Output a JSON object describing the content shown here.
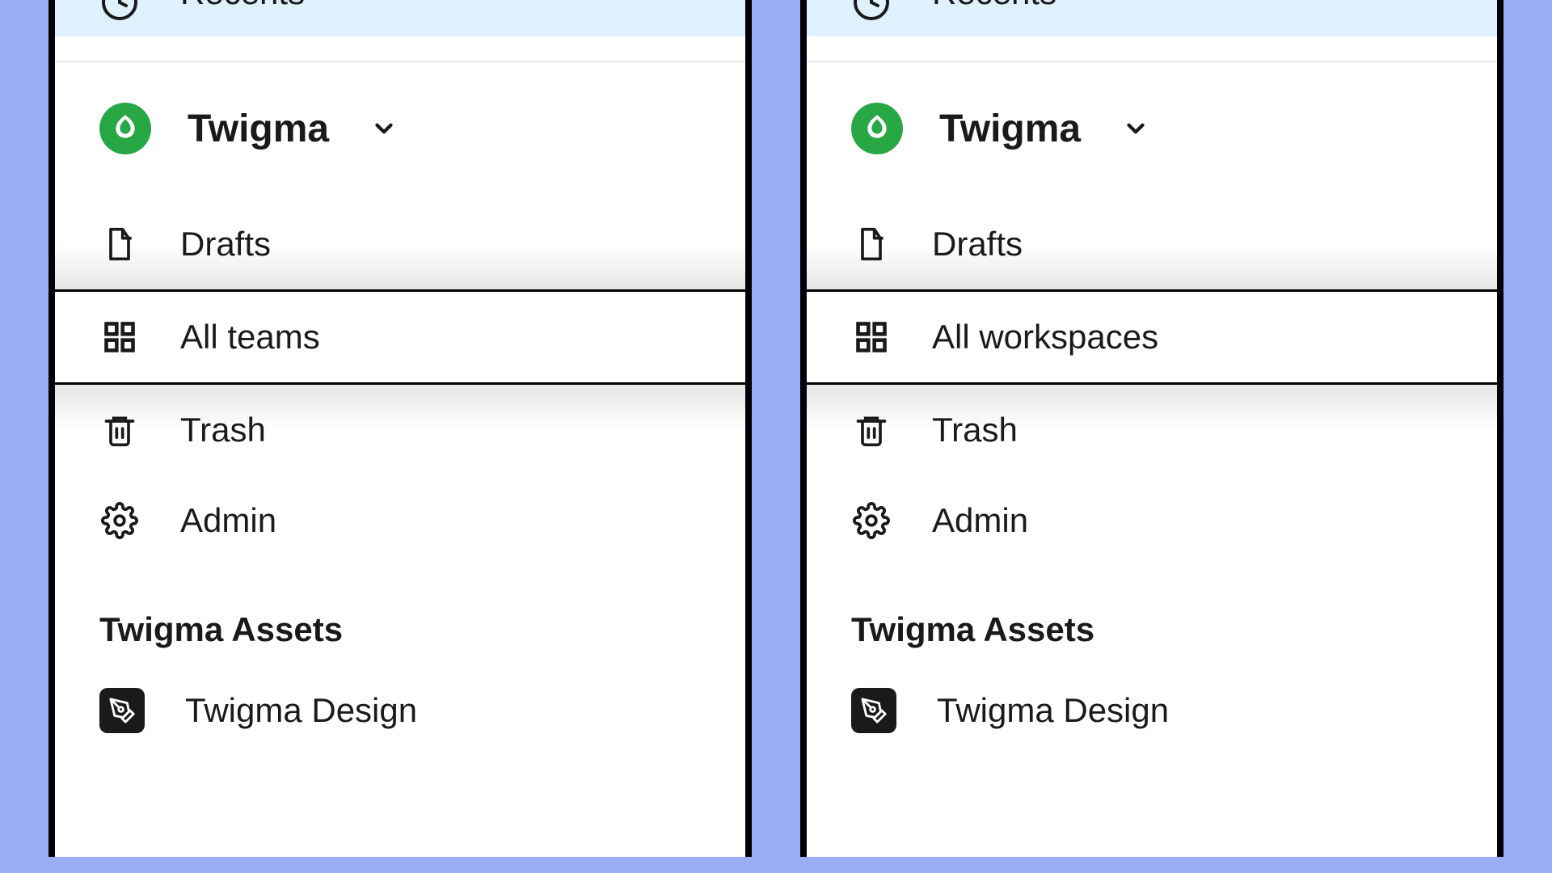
{
  "left": {
    "recents": "Recents",
    "org": "Twigma",
    "nav": {
      "drafts": "Drafts",
      "allteams": "All teams",
      "trash": "Trash",
      "admin": "Admin"
    },
    "section": "Twigma Assets",
    "asset1": "Twigma Design"
  },
  "right": {
    "recents": "Recents",
    "org": "Twigma",
    "nav": {
      "drafts": "Drafts",
      "allworkspaces": "All workspaces",
      "trash": "Trash",
      "admin": "Admin"
    },
    "section": "Twigma Assets",
    "asset1": "Twigma Design"
  }
}
